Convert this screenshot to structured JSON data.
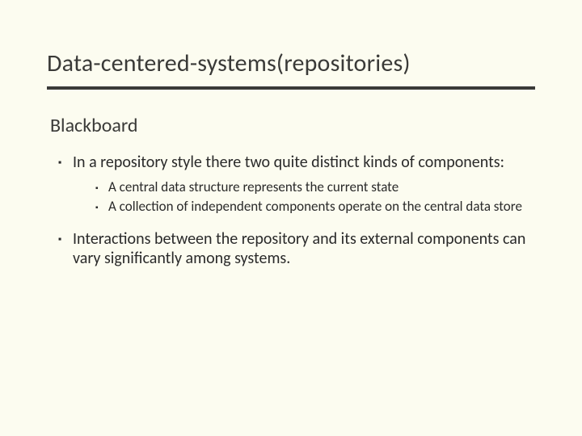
{
  "title": "Data-centered-systems(repositories)",
  "subtitle": "Blackboard",
  "bullets": {
    "b1": "In a repository style there two quite distinct kinds of components:",
    "b1_sub1": "A central data structure represents the current state",
    "b1_sub2": "A collection of independent components operate on the central data store",
    "b2": "Interactions between the repository and its external components can vary significantly among systems."
  }
}
